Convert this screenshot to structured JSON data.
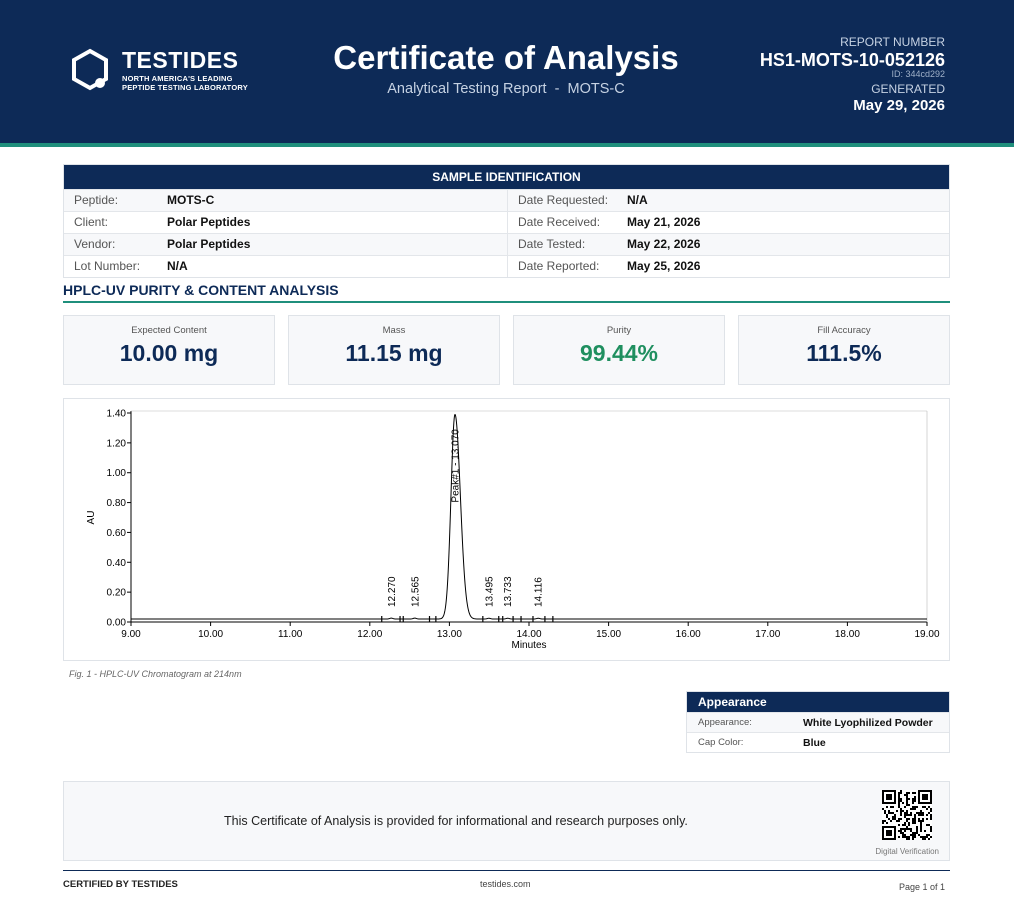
{
  "header": {
    "brand_name": "TESTIDES",
    "brand_tag_line1": "NORTH AMERICA'S LEADING",
    "brand_tag_line2": "PEPTIDE TESTING LABORATORY",
    "title": "Certificate of Analysis",
    "subtitle": "Analytical Testing Report  -  MOTS-C",
    "report_number_label": "REPORT NUMBER",
    "report_number": "HS1-MOTS-10-052126",
    "report_id": "ID: 344cd292",
    "generated_label": "GENERATED",
    "generated_date": "May 29, 2026",
    "colors": {
      "navy": "#0d2a57",
      "teal": "#1f8f7c"
    }
  },
  "sample": {
    "heading": "SAMPLE IDENTIFICATION",
    "rows": [
      {
        "l1": "Peptide:",
        "v1": "MOTS-C",
        "l2": "Date Requested:",
        "v2": "N/A"
      },
      {
        "l1": "Client:",
        "v1": "Polar Peptides",
        "l2": "Date Received:",
        "v2": "May 21, 2026"
      },
      {
        "l1": "Vendor:",
        "v1": "Polar Peptides",
        "l2": "Date Tested:",
        "v2": "May 22, 2026"
      },
      {
        "l1": "Lot Number:",
        "v1": "N/A",
        "l2": "Date Reported:",
        "v2": "May 25, 2026"
      }
    ]
  },
  "analysis": {
    "section_title": "HPLC-UV PURITY & CONTENT ANALYSIS",
    "metrics": [
      {
        "label": "Expected Content",
        "value": "10.00 mg"
      },
      {
        "label": "Mass",
        "value": "11.15 mg"
      },
      {
        "label": "Purity",
        "value": "99.44%",
        "color": "#1f8f5f"
      },
      {
        "label": "Fill Accuracy",
        "value": "111.5%"
      }
    ],
    "figure_caption": "Fig. 1  -  HPLC-UV Chromatogram at 214nm"
  },
  "chart_data": {
    "type": "line",
    "xlabel": "Minutes",
    "ylabel": "AU",
    "xlim": [
      9.0,
      19.0
    ],
    "ylim": [
      0.0,
      1.4
    ],
    "x_ticks": [
      "9.00",
      "10.00",
      "11.00",
      "12.00",
      "13.00",
      "14.00",
      "15.00",
      "16.00",
      "17.00",
      "18.00",
      "19.00"
    ],
    "y_ticks": [
      "0.00",
      "0.20",
      "0.40",
      "0.60",
      "0.80",
      "1.00",
      "1.20",
      "1.40"
    ],
    "main_peak": {
      "label": "Peak#1 - 13.070",
      "rt": 13.07,
      "height": 1.37,
      "width": 0.05
    },
    "minor_peaks": [
      {
        "label": "12.270",
        "rt": 12.27,
        "height": 0.006
      },
      {
        "label": "12.565",
        "rt": 12.565,
        "height": 0.006
      },
      {
        "label": "13.495",
        "rt": 13.495,
        "height": 0.005
      },
      {
        "label": "13.733",
        "rt": 13.733,
        "height": 0.005
      },
      {
        "label": "14.116",
        "rt": 14.116,
        "height": 0.005
      }
    ],
    "baseline": 0.02,
    "integration_marks": [
      12.15,
      12.38,
      12.42,
      12.75,
      12.83,
      13.42,
      13.62,
      13.67,
      13.8,
      13.9,
      14.05,
      14.2,
      14.3
    ]
  },
  "appearance": {
    "heading": "Appearance",
    "rows": [
      {
        "label": "Appearance:",
        "value": "White Lyophilized Powder"
      },
      {
        "label": "Cap Color:",
        "value": "Blue"
      }
    ]
  },
  "disclaimer": {
    "text": "This Certificate of Analysis is provided for informational and research purposes only.",
    "qr_label": "Digital Verification"
  },
  "footer": {
    "certified": "CERTIFIED BY TESTIDES",
    "site": "testides.com",
    "page": "Page 1 of 1"
  }
}
